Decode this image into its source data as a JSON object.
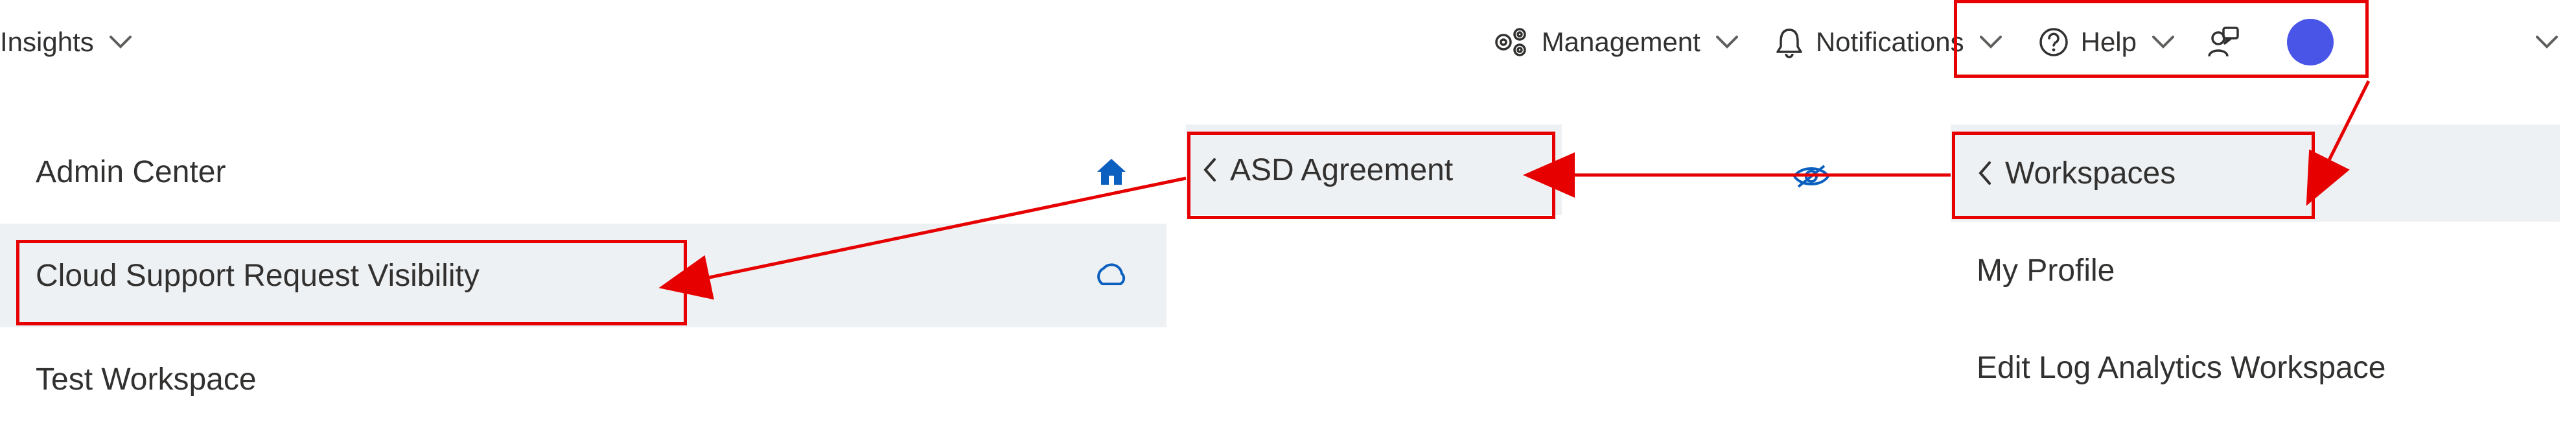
{
  "nav": {
    "insights": "Insights",
    "management": "Management",
    "notifications": "Notifications",
    "help": "Help"
  },
  "admin_panel": {
    "header": "Admin Center",
    "cloud_support": "Cloud Support Request Visibility",
    "test_workspace": "Test Workspace"
  },
  "asd_panel": {
    "header": "ASD Agreement"
  },
  "ws_panel": {
    "header": "Workspaces",
    "my_profile": "My Profile",
    "edit_law": "Edit Log Analytics Workspace"
  }
}
